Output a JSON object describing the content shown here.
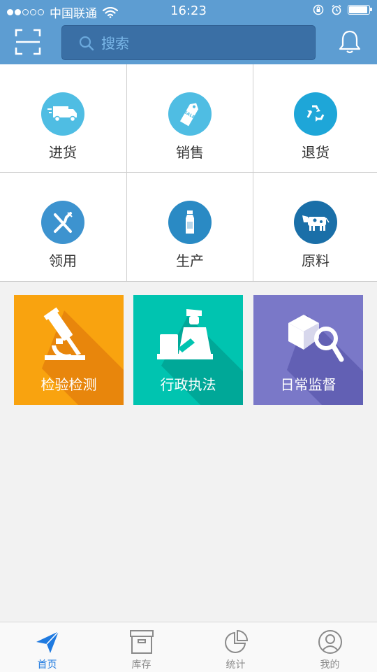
{
  "status_bar": {
    "carrier": "中国联通",
    "time": "16:23",
    "signal_dots_filled": 2,
    "signal_dots_total": 5,
    "battery_level": 0.95
  },
  "header": {
    "scan_icon": "scan-frame-icon",
    "search_placeholder": "搜索",
    "bell_icon": "bell-icon",
    "background_color": "#5d9dd2"
  },
  "functions": [
    {
      "label": "进货",
      "icon": "delivery-truck-icon",
      "color": "#4fbde3"
    },
    {
      "label": "销售",
      "icon": "sale-tag-icon",
      "color": "#4fbde3"
    },
    {
      "label": "退货",
      "icon": "recycle-arrows-icon",
      "color": "#1ea6d8"
    },
    {
      "label": "领用",
      "icon": "fork-knife-icon",
      "color": "#3d93cf"
    },
    {
      "label": "生产",
      "icon": "milk-bottle-icon",
      "color": "#2a8ac4"
    },
    {
      "label": "原料",
      "icon": "cow-icon",
      "color": "#1a6fa8"
    }
  ],
  "tiles": [
    {
      "label": "检验检测",
      "icon": "microscope-icon",
      "color": "#f9a30f",
      "shade": "#e8860c"
    },
    {
      "label": "行政执法",
      "icon": "officer-icon",
      "color": "#00c4b0",
      "shade": "#00a898"
    },
    {
      "label": "日常监督",
      "icon": "box-magnifier-icon",
      "color": "#7a78c8",
      "shade": "#6260b4"
    }
  ],
  "tabbar": {
    "items": [
      {
        "label": "首页",
        "icon": "paper-plane-icon",
        "active": true
      },
      {
        "label": "库存",
        "icon": "archive-box-icon",
        "active": false
      },
      {
        "label": "统计",
        "icon": "pie-chart-icon",
        "active": false
      },
      {
        "label": "我的",
        "icon": "user-profile-icon",
        "active": false
      }
    ],
    "active_color": "#1f7ae0",
    "inactive_color": "#8a8a8a"
  }
}
